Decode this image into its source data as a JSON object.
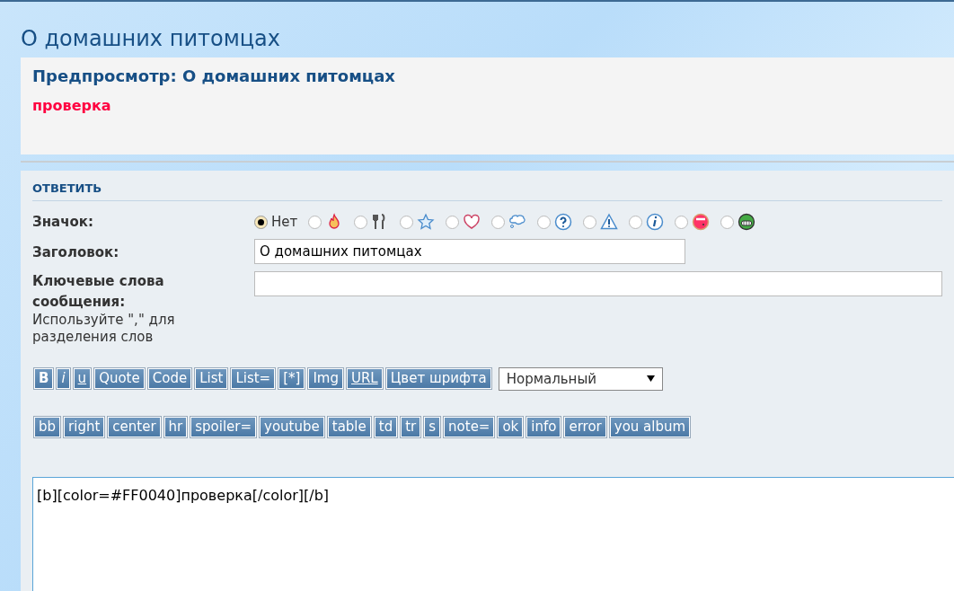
{
  "page_title": "О домашних питомцах",
  "preview": {
    "title": "Предпросмотр: О домашних питомцах",
    "body": "проверка"
  },
  "reply": {
    "heading": "ОТВЕТИТЬ",
    "icon_label": "Значок:",
    "icon_options": [
      {
        "kind": "none",
        "label": "Нет",
        "selected": true
      },
      {
        "kind": "fire",
        "selected": false
      },
      {
        "kind": "cutlery",
        "selected": false
      },
      {
        "kind": "star",
        "selected": false
      },
      {
        "kind": "heart",
        "selected": false
      },
      {
        "kind": "thought",
        "selected": false
      },
      {
        "kind": "question",
        "selected": false
      },
      {
        "kind": "warning",
        "selected": false
      },
      {
        "kind": "info",
        "selected": false
      },
      {
        "kind": "blush",
        "selected": false
      },
      {
        "kind": "grin",
        "selected": false
      }
    ],
    "subject_label": "Заголовок:",
    "subject_value": "О домашних питомцах",
    "keywords_label": "Ключевые слова сообщения:",
    "keywords_hint": "Используйте \",\" для разделения слов",
    "toolbar_row_1": [
      {
        "label": "B",
        "kind": "bold"
      },
      {
        "label": "i",
        "kind": "italic"
      },
      {
        "label": " u ",
        "kind": "underline"
      },
      {
        "label": "Quote",
        "kind": "plain"
      },
      {
        "label": "Code",
        "kind": "plain"
      },
      {
        "label": "List",
        "kind": "plain"
      },
      {
        "label": "List=",
        "kind": "plain"
      },
      {
        "label": "[*]",
        "kind": "plain"
      },
      {
        "label": "Img",
        "kind": "plain"
      },
      {
        "label": "URL",
        "kind": "underline"
      },
      {
        "label": "Цвет шрифта",
        "kind": "plain"
      }
    ],
    "font_size_select": "Нормальный",
    "toolbar_row_2": [
      {
        "label": "bb"
      },
      {
        "label": "right"
      },
      {
        "label": "center"
      },
      {
        "label": "hr"
      },
      {
        "label": "spoiler="
      },
      {
        "label": "youtube"
      },
      {
        "label": "table"
      },
      {
        "label": "td"
      },
      {
        "label": "tr"
      },
      {
        "label": "s"
      },
      {
        "label": "note="
      },
      {
        "label": "ok"
      },
      {
        "label": "info"
      },
      {
        "label": "error"
      },
      {
        "label": "you album"
      }
    ],
    "message": "[b][color=#FF0040]проверка[/color][/b]"
  }
}
